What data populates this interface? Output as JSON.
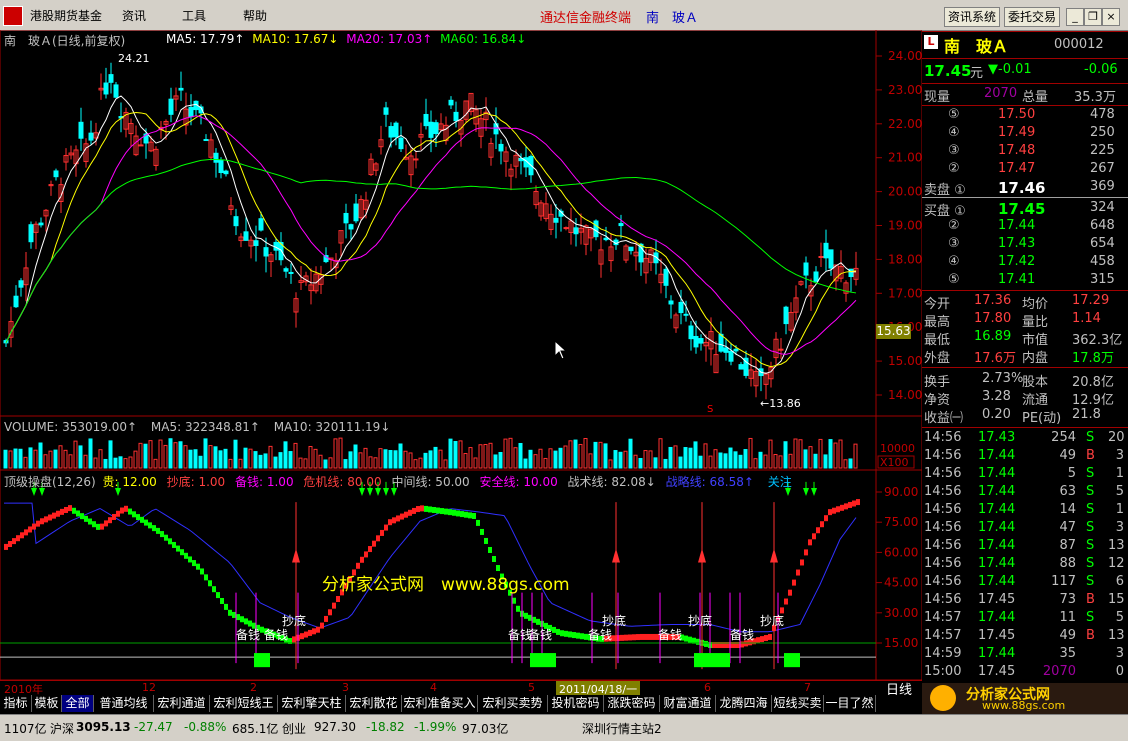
{
  "menu": {
    "items": [
      "港股期货基金",
      "资讯",
      "工具",
      "帮助"
    ],
    "app_title": "通达信金融终端",
    "stock_title": "南　玻Ａ",
    "buttons": [
      "资讯系统",
      "委托交易"
    ]
  },
  "header": {
    "label": "南　玻Ａ(日线,前复权)",
    "ma": [
      {
        "text": "MA5: 17.79↑",
        "color": "#ffffff"
      },
      {
        "text": "MA10: 17.67↓",
        "color": "#ffff00"
      },
      {
        "text": "MA20: 17.03↑",
        "color": "#ff00ff"
      },
      {
        "text": "MA60: 16.84↓",
        "color": "#00ff00"
      }
    ]
  },
  "price_axis": [
    "24.00",
    "23.00",
    "22.00",
    "21.00",
    "20.00",
    "19.00",
    "18.00",
    "17.00",
    "16.00",
    "15.00",
    "14.00"
  ],
  "current_price_tag": "15.63",
  "annotations": {
    "high": "24.21",
    "low": "←13.86",
    "s_marker": "S"
  },
  "volume": {
    "header": [
      {
        "text": "VOLUME: 353019.00↑",
        "color": "#c0c0c0"
      },
      {
        "text": "MA5: 322348.81↑",
        "color": "#c0c0c0"
      },
      {
        "text": "MA10: 320111.19↓",
        "color": "#c0c0c0"
      }
    ],
    "axis": [
      "10000",
      "X100"
    ]
  },
  "indicator": {
    "header": [
      {
        "text": "顶级操盘(12,26)",
        "color": "#c0c0c0"
      },
      {
        "text": "贵: 12.00",
        "color": "#ffff00"
      },
      {
        "text": "抄底: 1.00",
        "color": "#ff4040"
      },
      {
        "text": "备钱: 1.00",
        "color": "#ff00ff"
      },
      {
        "text": "危机线: 80.00",
        "color": "#ff4040"
      },
      {
        "text": "中间线: 50.00",
        "color": "#c0c0c0"
      },
      {
        "text": "安全线: 10.00",
        "color": "#ff00ff"
      },
      {
        "text": "战术线: 82.08↓",
        "color": "#c0c0c0"
      },
      {
        "text": "战略线: 68.58↑",
        "color": "#4040ff"
      },
      {
        "text": "关注",
        "color": "#00c0ff"
      }
    ],
    "axis": [
      "90.00",
      "75.00",
      "60.00",
      "45.00",
      "30.00",
      "15.00"
    ],
    "watermark": "分析家公式网　www.88gs.com",
    "labels_chaodi": "抄底",
    "labels_beiqian": "备钱"
  },
  "date_axis": {
    "start": "2010年",
    "marks": [
      "12",
      "2",
      "3",
      "4",
      "5",
      "6",
      "7"
    ],
    "cursor_date": "2011/04/18/一",
    "period": "日线"
  },
  "quote": {
    "name": "南　玻Ａ",
    "code": "000012",
    "price": "17.45",
    "price_unit": "元",
    "change": "▼-0.01",
    "change2": "-0.06",
    "xianliang_label": "现量",
    "xianliang": "2070",
    "zongliang_label": "总量",
    "zongliang": "35.3万",
    "sell": [
      {
        "label": "⑤",
        "price": "17.50",
        "vol": "478"
      },
      {
        "label": "④",
        "price": "17.49",
        "vol": "250"
      },
      {
        "label": "③",
        "price": "17.48",
        "vol": "225"
      },
      {
        "label": "②",
        "price": "17.47",
        "vol": "267"
      },
      {
        "label": "卖盘 ①",
        "price": "17.46",
        "vol": "369"
      }
    ],
    "buy": [
      {
        "label": "买盘 ①",
        "price": "17.45",
        "vol": "324"
      },
      {
        "label": "②",
        "price": "17.44",
        "vol": "648"
      },
      {
        "label": "③",
        "price": "17.43",
        "vol": "654"
      },
      {
        "label": "④",
        "price": "17.42",
        "vol": "458"
      },
      {
        "label": "⑤",
        "price": "17.41",
        "vol": "315"
      }
    ],
    "stats": [
      {
        "l1": "今开",
        "v1": "17.36",
        "l2": "均价",
        "v2": "17.29",
        "c1": "#ff4040",
        "c2": "#ff4040"
      },
      {
        "l1": "最高",
        "v1": "17.80",
        "l2": "量比",
        "v2": "1.14",
        "c1": "#ff4040",
        "c2": "#ff4040"
      },
      {
        "l1": "最低",
        "v1": "16.89",
        "l2": "市值",
        "v2": "362.3亿",
        "c1": "#00ff00",
        "c2": "#c0c0c0"
      },
      {
        "l1": "外盘",
        "v1": "17.6万",
        "l2": "内盘",
        "v2": "17.8万",
        "c1": "#ff4040",
        "c2": "#00ff00"
      }
    ],
    "stats2": [
      {
        "l1": "换手",
        "v1": "2.73%",
        "l2": "股本",
        "v2": "20.8亿"
      },
      {
        "l1": "净资",
        "v1": "3.28",
        "l2": "流通",
        "v2": "12.9亿"
      },
      {
        "l1": "收益㈠",
        "v1": "0.20",
        "l2": "PE(动)",
        "v2": "21.8"
      }
    ],
    "ticks": [
      {
        "t": "14:56",
        "p": "17.43",
        "v": "254",
        "d": "S",
        "n": "20"
      },
      {
        "t": "14:56",
        "p": "17.44",
        "v": "49",
        "d": "B",
        "n": "3"
      },
      {
        "t": "14:56",
        "p": "17.44",
        "v": "5",
        "d": "S",
        "n": "1"
      },
      {
        "t": "14:56",
        "p": "17.44",
        "v": "63",
        "d": "S",
        "n": "5"
      },
      {
        "t": "14:56",
        "p": "17.44",
        "v": "14",
        "d": "S",
        "n": "1"
      },
      {
        "t": "14:56",
        "p": "17.44",
        "v": "47",
        "d": "S",
        "n": "3"
      },
      {
        "t": "14:56",
        "p": "17.44",
        "v": "87",
        "d": "S",
        "n": "13"
      },
      {
        "t": "14:56",
        "p": "17.44",
        "v": "88",
        "d": "S",
        "n": "12"
      },
      {
        "t": "14:56",
        "p": "17.44",
        "v": "117",
        "d": "S",
        "n": "6"
      },
      {
        "t": "14:56",
        "p": "17.45",
        "v": "73",
        "d": "B",
        "n": "15"
      },
      {
        "t": "14:57",
        "p": "17.44",
        "v": "11",
        "d": "S",
        "n": "5"
      },
      {
        "t": "14:57",
        "p": "17.45",
        "v": "49",
        "d": "B",
        "n": "13"
      },
      {
        "t": "14:59",
        "p": "17.44",
        "v": "35",
        "d": "",
        "n": "3"
      },
      {
        "t": "15:00",
        "p": "17.45",
        "v": "2070",
        "d": "",
        "n": "0"
      }
    ]
  },
  "tabs": [
    "指标",
    "模板",
    "全部",
    "普通均线",
    "宏利通道",
    "宏利短线王",
    "宏利擎天柱",
    "宏利散花",
    "宏利准备买入",
    "宏利买卖势",
    "投机密码",
    "涨跌密码",
    "财富通道",
    "龙腾四海",
    "短线买卖",
    "一目了然"
  ],
  "status": {
    "a": "1107亿",
    "hs_label": "沪深",
    "hs_val": "3095.13",
    "hs_chg": "-27.47",
    "hs_pct": "-0.88%",
    "hs_amt": "685.1亿",
    "cy_label": "创业",
    "cy_val": "927.30",
    "cy_chg": "-18.82",
    "cy_pct": "-1.99%",
    "cy_amt": "97.03亿",
    "station": "深圳行情主站2"
  },
  "ad": {
    "text": "分析家公式网",
    "url": "www.88gs.com"
  }
}
